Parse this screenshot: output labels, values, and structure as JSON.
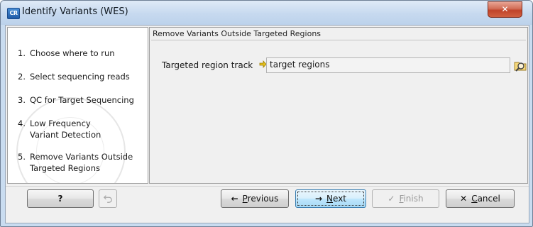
{
  "window": {
    "title": "Identify Variants (WES)",
    "app_icon_text": "CR",
    "close_glyph": "✕"
  },
  "steps": [
    {
      "num": "1.",
      "label": "Choose where to run"
    },
    {
      "num": "2.",
      "label": "Select sequencing reads"
    },
    {
      "num": "3.",
      "label": "QC for Target Sequencing"
    },
    {
      "num": "4.",
      "label": "Low Frequency Variant Detection"
    },
    {
      "num": "5.",
      "label": "Remove Variants Outside Targeted Regions"
    }
  ],
  "panel": {
    "title": "Remove Variants Outside Targeted Regions",
    "field_label": "Targeted region track",
    "field_value": "target regions",
    "track_icon": "track-icon",
    "browse_icon": "folder-search-icon"
  },
  "buttons": {
    "help": "?",
    "reset_icon": "undo-icon",
    "previous": {
      "pre": "",
      "key": "P",
      "post": "revious",
      "icon": "←"
    },
    "next": {
      "pre": "",
      "key": "N",
      "post": "ext",
      "icon": "→"
    },
    "finish": {
      "pre": "",
      "key": "F",
      "post": "inish",
      "icon": "✓"
    },
    "cancel": {
      "pre": "",
      "key": "C",
      "post": "ancel",
      "icon": "✕"
    }
  }
}
